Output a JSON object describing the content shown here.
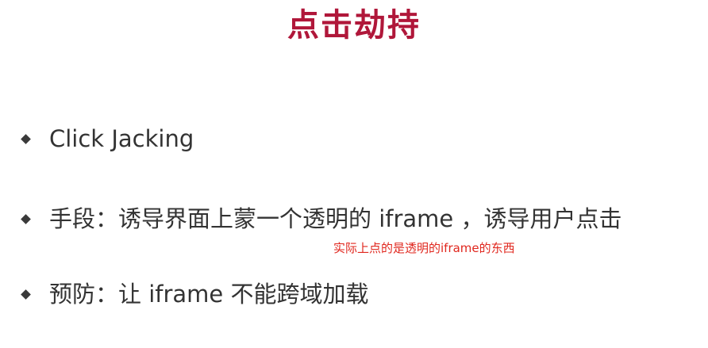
{
  "title": "点击劫持",
  "bullets": [
    {
      "text": "Click Jacking"
    },
    {
      "text": "手段：诱导界面上蒙一个透明的 iframe ，诱导用户点击"
    },
    {
      "text": "预防：让 iframe 不能跨域加载"
    }
  ],
  "annotation": "实际上点的是透明的iframe的东西",
  "colors": {
    "title": "#b0173a",
    "text": "#333333",
    "annotation": "#e0271e"
  }
}
